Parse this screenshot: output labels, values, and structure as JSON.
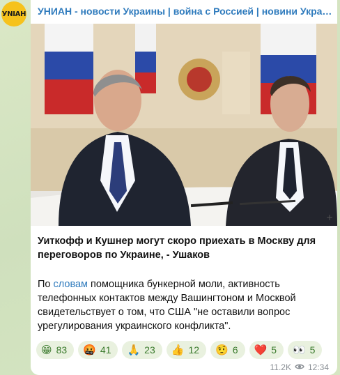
{
  "channel": {
    "name": "УНИАН - новости Украины | война с Россией | новини Украї...",
    "avatar_text": "УNIАН"
  },
  "post": {
    "headline": "Уиткофф и Кушнер могут скоро приехать в Москву для переговоров по Украине, - Ушаков",
    "body_prefix": "По ",
    "body_link": "словам",
    "body_rest": " помощника бункерной моли, активность телефонных контактов между Вашингтоном и Москвой свидетельствует о том, что США \"не оставили вопрос урегулирования украинского конфликта\"."
  },
  "reactions": [
    {
      "emoji": "😁",
      "icon": "grinning-face-icon",
      "count": "83"
    },
    {
      "emoji": "🤬",
      "icon": "angry-face-icon",
      "count": "41"
    },
    {
      "emoji": "🙏",
      "icon": "folded-hands-icon",
      "count": "23"
    },
    {
      "emoji": "👍",
      "icon": "thumbs-up-icon",
      "count": "12"
    },
    {
      "emoji": "🤨",
      "icon": "raised-eyebrow-face-icon",
      "count": "6"
    },
    {
      "emoji": "❤️",
      "icon": "red-heart-icon",
      "count": "5"
    },
    {
      "emoji": "👀",
      "icon": "eyes-icon",
      "count": "5"
    }
  ],
  "meta": {
    "views": "11.2K",
    "time": "12:34"
  },
  "colors": {
    "accent": "#2f7bbd",
    "reaction_bg": "#e9f1df",
    "reaction_text": "#3a7a2c",
    "avatar_bg": "#f6c21c",
    "background": "#d5e4c3"
  }
}
